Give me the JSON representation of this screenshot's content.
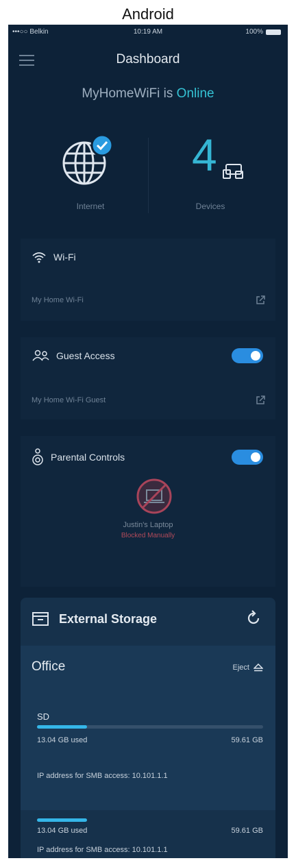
{
  "caption": "Android",
  "status_bar": {
    "carrier": "•••○○ Belkin",
    "time": "10:19 AM",
    "battery": "100%"
  },
  "header": {
    "title": "Dashboard",
    "status_prefix": "MyHomeWiFi is",
    "status_value": "Online"
  },
  "tiles": {
    "internet": {
      "label": "Internet",
      "icon": "globe-check-icon"
    },
    "devices": {
      "count": "4",
      "label": "Devices",
      "icon": "devices-icon"
    }
  },
  "wifi": {
    "title": "Wi-Fi",
    "network": "My Home Wi-Fi"
  },
  "guest": {
    "title": "Guest Access",
    "network": "My Home Wi-Fi Guest",
    "enabled": true
  },
  "parental": {
    "title": "Parental Controls",
    "enabled": true,
    "device_name": "Justin's Laptop",
    "device_status": "Blocked Manually"
  },
  "storage": {
    "title": "External Storage",
    "drive_name": "Office",
    "eject_label": "Eject",
    "volume_label": "SD",
    "used_fraction": 0.22,
    "used": "13.04 GB used",
    "total": "59.61 GB",
    "ip_text": "IP address for SMB access: 10.101.1.1",
    "used_2": "13.04 GB used",
    "total_2": "59.61 GB",
    "ip_text_2": "IP address for SMB access: 10.101.1.1"
  },
  "colors": {
    "background": "#0d2238",
    "accent": "#35c2d4",
    "toggle": "#2a8de0",
    "blocked": "#b24a5a"
  }
}
